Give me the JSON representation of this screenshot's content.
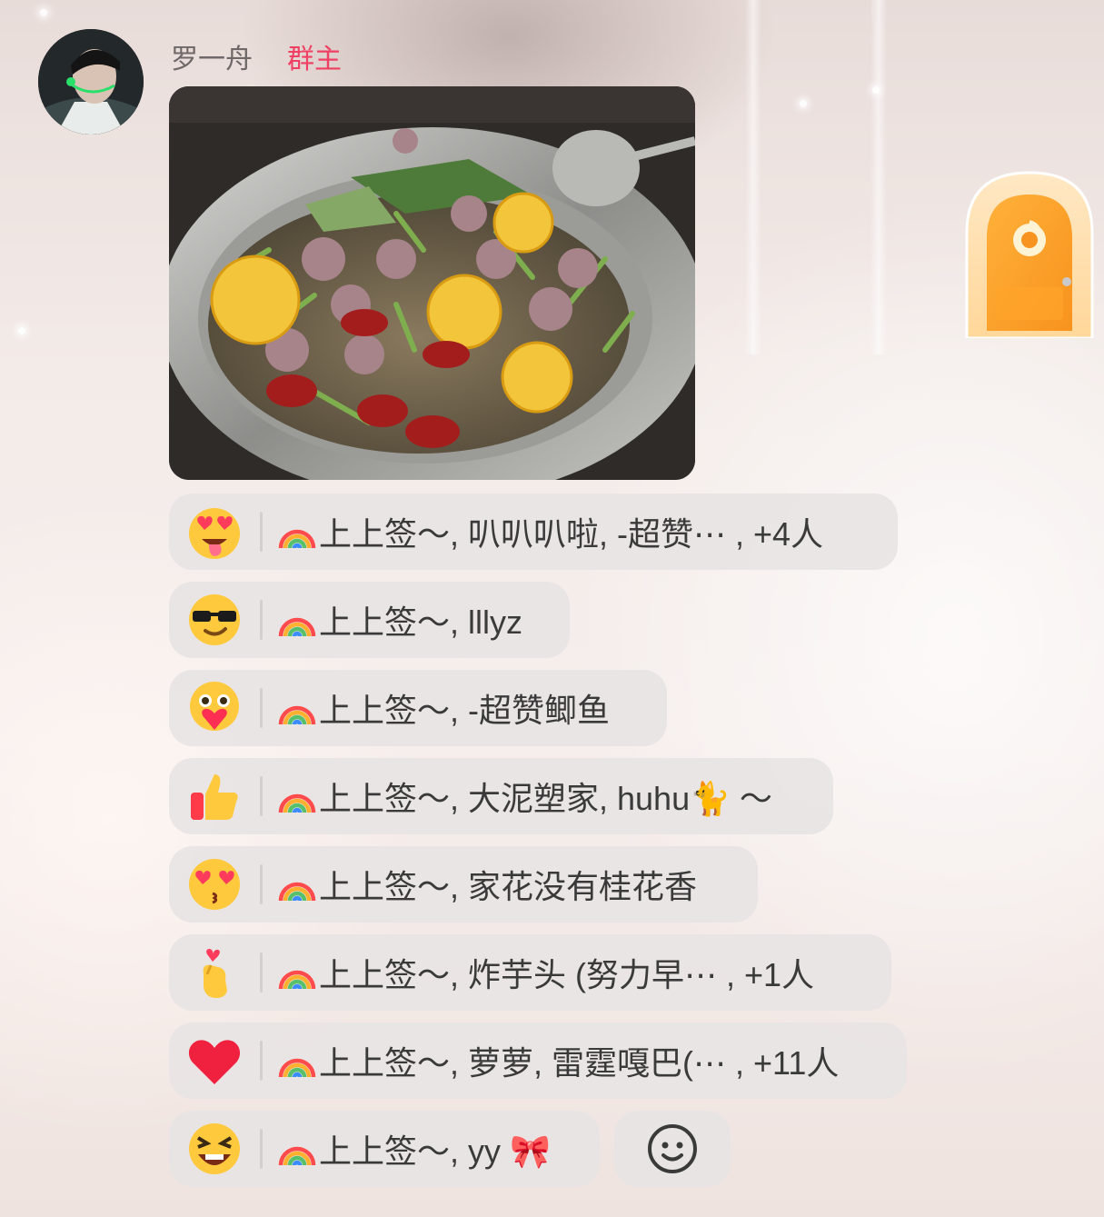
{
  "message": {
    "sender": "罗一舟",
    "role_badge": "群主",
    "avatar": "user-avatar-photo",
    "image": "hotpot-photo"
  },
  "reactions": [
    {
      "emoji": "heart-eyes-tongue-emoji",
      "text": "上上签～, 叭叭叭啦, -超赞⋯ , +4人"
    },
    {
      "emoji": "sunglasses-emoji",
      "text": "上上签～, lllyz"
    },
    {
      "emoji": "hugging-heart-emoji",
      "text": "上上签～, -超赞鲫鱼"
    },
    {
      "emoji": "thumbs-up-emoji",
      "text": "上上签～, 大泥塑家, huhu🐈 ～"
    },
    {
      "emoji": "kissing-heart-eyes-emoji",
      "text": "上上签～, 家花没有桂花香"
    },
    {
      "emoji": "finger-heart-emoji",
      "text": "上上签～, 炸芋头 (努力早⋯ , +1人"
    },
    {
      "emoji": "red-heart-emoji",
      "text": "上上签～, 萝萝, 雷霆嘎巴(⋯ , +11人"
    },
    {
      "emoji": "grinning-squint-emoji",
      "text": "上上签～, yy 🎀"
    }
  ],
  "add_reaction": "smiley-add-reaction-icon",
  "colors": {
    "badge": "#ef3f62",
    "pill": "#e8e4e4",
    "door": "#f7931e"
  }
}
